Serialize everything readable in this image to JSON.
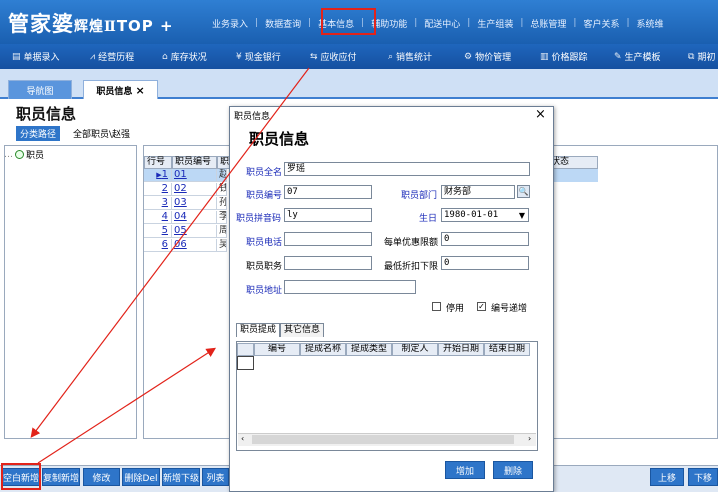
{
  "app": {
    "logo_text": "管家婆",
    "edition": "辉煌Ⅱ",
    "product": "TOP +"
  },
  "top_nav": [
    "业务录入",
    "数据查询",
    "基本信息",
    "辅助功能",
    "配送中心",
    "生产组装",
    "总账管理",
    "客户关系",
    "系统维"
  ],
  "toolbar": [
    {
      "label": "单据录入",
      "icon": "document-icon"
    },
    {
      "label": "经营历程",
      "icon": "chart-icon"
    },
    {
      "label": "库存状况",
      "icon": "home-icon"
    },
    {
      "label": "现金银行",
      "icon": "yen-icon"
    },
    {
      "label": "应收应付",
      "icon": "exchange-icon"
    },
    {
      "label": "销售统计",
      "icon": "search-icon"
    },
    {
      "label": "物价管理",
      "icon": "gear-icon"
    },
    {
      "label": "价格跟踪",
      "icon": "bar-chart-icon"
    },
    {
      "label": "生产模板",
      "icon": "wrench-icon"
    },
    {
      "label": "期初",
      "icon": "external-icon"
    }
  ],
  "tabs": {
    "nav": "导航图",
    "employee": "职员信息",
    "close": "×"
  },
  "page": {
    "title": "职员信息",
    "category_button": "分类路径",
    "breadcrumb": "全部职员\\赵强",
    "tree_root": "职员"
  },
  "grid": {
    "columns": [
      "行号",
      "职员编号",
      "职"
    ],
    "status_column": "状态",
    "rows": [
      {
        "no": "1",
        "code": "01",
        "name": "赵",
        "selected": true
      },
      {
        "no": "2",
        "code": "02",
        "name": "钱",
        "selected": false
      },
      {
        "no": "3",
        "code": "03",
        "name": "孙",
        "selected": false
      },
      {
        "no": "4",
        "code": "04",
        "name": "李",
        "selected": false
      },
      {
        "no": "5",
        "code": "05",
        "name": "周",
        "selected": false
      },
      {
        "no": "6",
        "code": "06",
        "name": "吴",
        "selected": false
      }
    ]
  },
  "bottom_buttons": [
    "空白新增",
    "复制新增",
    "修改",
    "删除Del",
    "新增下级",
    "列表"
  ],
  "bottom_right_buttons": [
    "上移",
    "下移"
  ],
  "dialog": {
    "window_title": "职员信息",
    "close": "×",
    "heading": "职员信息",
    "fields": {
      "full_name": {
        "label": "职员全名",
        "value": "罗瑶"
      },
      "code": {
        "label": "职员编号",
        "value": "07"
      },
      "department": {
        "label": "职员部门",
        "value": "财务部"
      },
      "pinyin": {
        "label": "职员拼音码",
        "value": "ly"
      },
      "birthday": {
        "label": "生日",
        "value": "1980-01-01"
      },
      "phone": {
        "label": "职员电话",
        "value": ""
      },
      "discount_limit": {
        "label": "每单优惠限额",
        "value": "0"
      },
      "position": {
        "label": "职员职务",
        "value": ""
      },
      "min_discount": {
        "label": "最低折扣下限",
        "value": "0"
      },
      "address": {
        "label": "职员地址",
        "value": ""
      }
    },
    "checkboxes": {
      "disabled": {
        "label": "停用",
        "checked": false
      },
      "auto_increment": {
        "label": "编号递增",
        "checked": true
      }
    },
    "sub_tabs": [
      "职员提成",
      "其它信息"
    ],
    "sub_grid_columns": [
      "",
      "编号",
      "提成名称",
      "提成类型",
      "制定人",
      "开始日期",
      "结束日期"
    ],
    "buttons": {
      "add": "增加",
      "delete": "删除"
    }
  },
  "colors": {
    "brand_blue": "#1a5fb0",
    "button_blue": "#2e75c9",
    "highlight_red": "#e2231a",
    "selected_row": "#bcd8f5"
  }
}
